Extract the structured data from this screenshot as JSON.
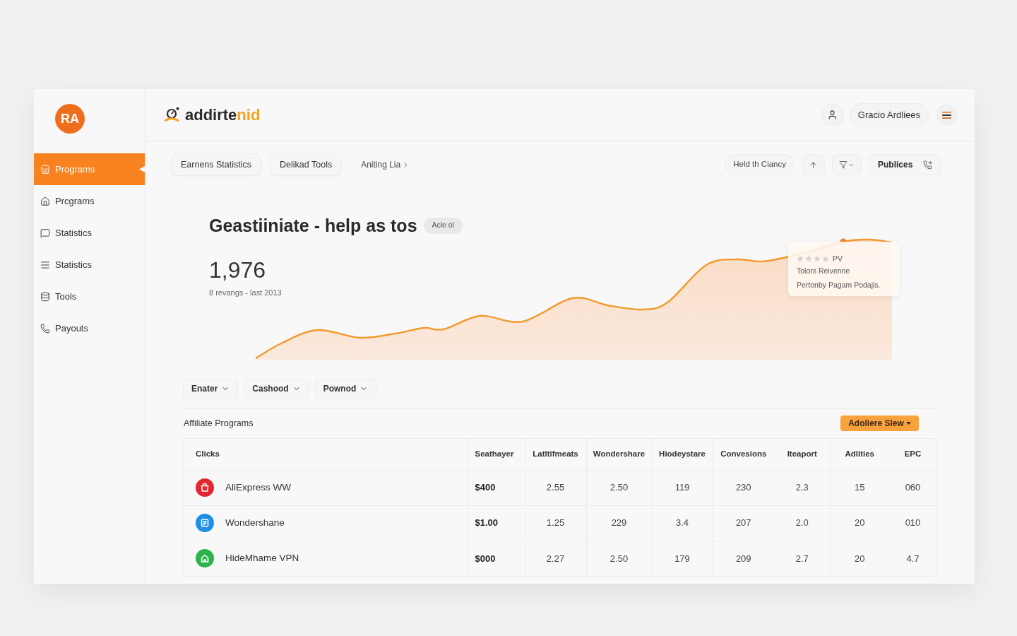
{
  "sidebar": {
    "avatar": {
      "initials": "RA"
    },
    "items": [
      {
        "label": "Programs",
        "selected": true
      },
      {
        "label": "Prcgrams",
        "selected": false
      },
      {
        "label": "Statistics",
        "selected": false
      },
      {
        "label": "Statistics",
        "selected": false
      },
      {
        "label": "Tools",
        "selected": false
      },
      {
        "label": "Payouts",
        "selected": false
      }
    ]
  },
  "header": {
    "logo": {
      "main": "addirte",
      "accent": "nid"
    },
    "user_name": "Gracio Ardliees"
  },
  "toolbar": {
    "left_buttons": [
      "Earnens Statistics",
      "Delikad Tools"
    ],
    "link": "Aniting Lia",
    "right_pill": "Held th Ciancy",
    "action_button": "Publices"
  },
  "overview": {
    "title": "Geastiiniate - help as tos",
    "badge": "Acle ol",
    "value": "1,976",
    "caption": "8 revangs - last 2013",
    "tooltip": {
      "stars": 0,
      "tag": "PV",
      "line_1": "Tolors Reivenne",
      "line_2": "Pertonby Pagam Podajis."
    }
  },
  "filters": [
    "Enater",
    "Cashood",
    "Pownod"
  ],
  "programs": {
    "title": "Affiliate Programs",
    "action": "Adoliere Slew",
    "columns": [
      "Clicks",
      "Seathayer",
      "Latltifmeats",
      "Wondershare",
      "Hiodeystare",
      "Convesions",
      "Iteaport",
      "Adlities",
      "EPC"
    ],
    "rows": [
      {
        "name": "AliExpress WW",
        "color": "#e3262f",
        "values": [
          "$400",
          "2.55",
          "2.50",
          "119",
          "230",
          "2.3",
          "15",
          "060"
        ]
      },
      {
        "name": "Wondershane",
        "color": "#1e8fe6",
        "values": [
          "$1.00",
          "1.25",
          "229",
          "3.4",
          "207",
          "2.0",
          "20",
          "010"
        ]
      },
      {
        "name": "HideMhame VPN",
        "color": "#2cb34a",
        "values": [
          "$000",
          "2.27",
          "2.50",
          "179",
          "209",
          "2.7",
          "20",
          "4.7"
        ]
      }
    ]
  }
}
